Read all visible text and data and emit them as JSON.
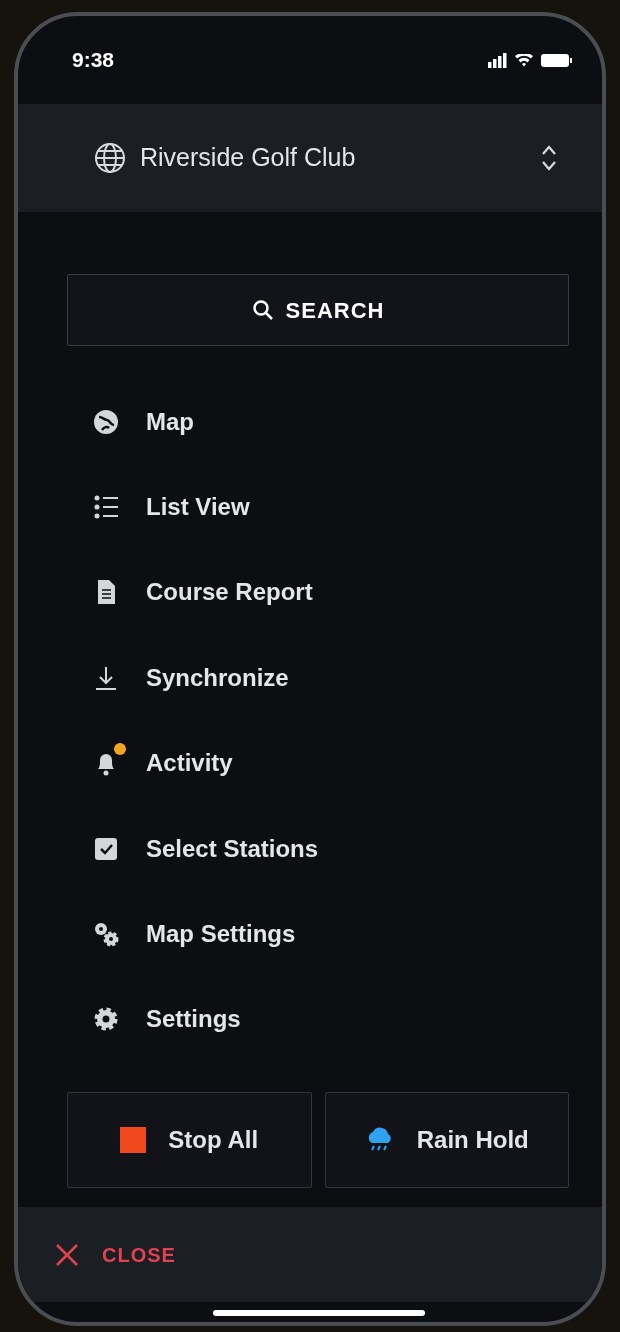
{
  "status_bar": {
    "time": "9:38"
  },
  "header": {
    "title": "Riverside Golf Club"
  },
  "search": {
    "label": "SEARCH"
  },
  "menu": [
    {
      "kind": "map",
      "label": "Map",
      "notification": false
    },
    {
      "kind": "list",
      "label": "List View",
      "notification": false
    },
    {
      "kind": "report",
      "label": "Course Report",
      "notification": false
    },
    {
      "kind": "sync",
      "label": "Synchronize",
      "notification": false
    },
    {
      "kind": "activity",
      "label": "Activity",
      "notification": true
    },
    {
      "kind": "select",
      "label": "Select Stations",
      "notification": false
    },
    {
      "kind": "map-settings",
      "label": "Map Settings",
      "notification": false
    },
    {
      "kind": "settings",
      "label": "Settings",
      "notification": false
    }
  ],
  "actions": [
    {
      "kind": "stop",
      "label": "Stop All"
    },
    {
      "kind": "rain",
      "label": "Rain Hold"
    }
  ],
  "footer": {
    "close": "CLOSE"
  }
}
